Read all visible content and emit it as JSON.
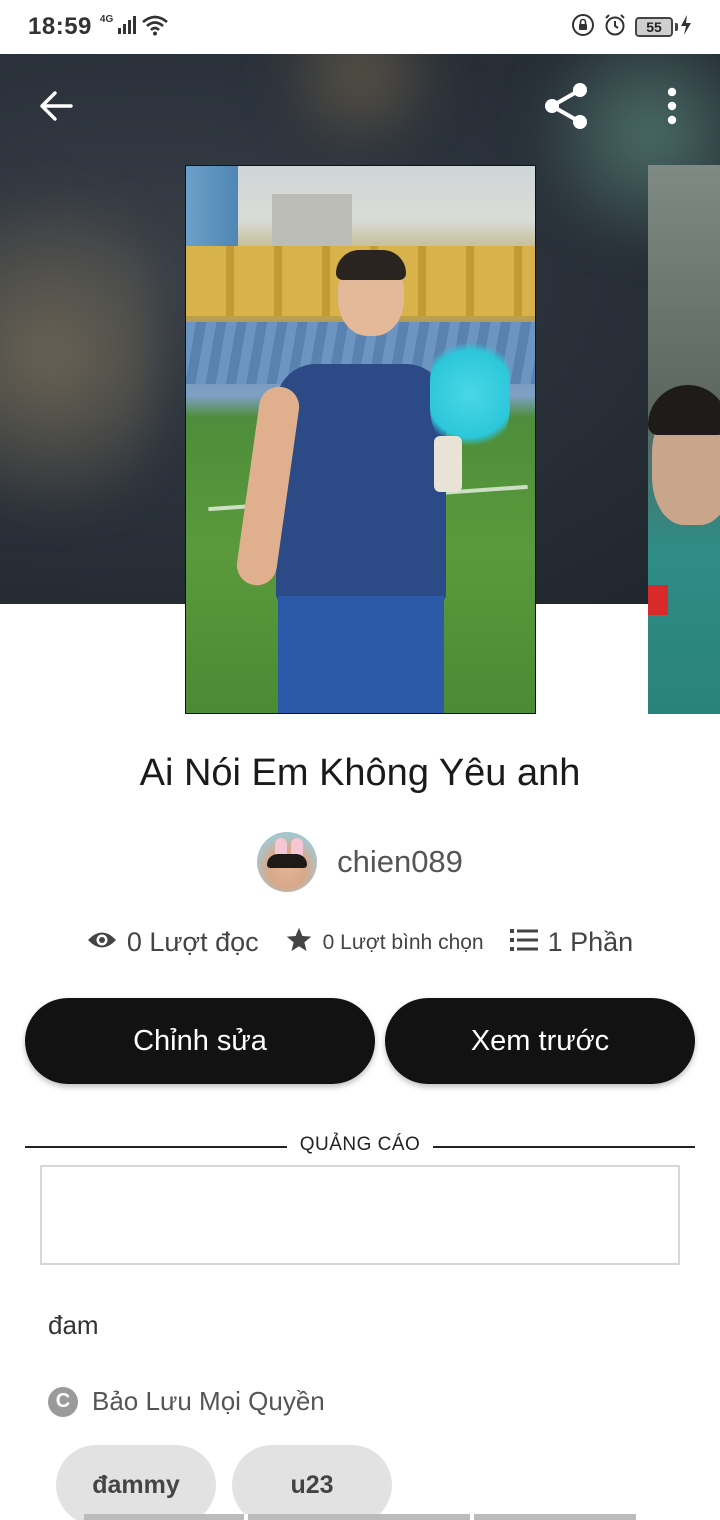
{
  "status_bar": {
    "time": "18:59",
    "network": "4G",
    "battery": "55"
  },
  "toolbar": {
    "back_icon": "back-arrow-icon",
    "share_icon": "share-icon",
    "more_icon": "more-vert-icon"
  },
  "story": {
    "title": "Ai Nói Em Không Yêu anh",
    "author": "chien089",
    "stats": {
      "reads": "0 Lượt đọc",
      "votes": "0 Lượt bình chọn",
      "parts": "1 Phần"
    },
    "description": "đam",
    "copyright": "Bảo Lưu Mọi Quyền",
    "tags": [
      "đammy",
      "u23"
    ]
  },
  "actions": {
    "edit_label": "Chỉnh sửa",
    "preview_label": "Xem trước"
  },
  "ad": {
    "label": "QUẢNG CÁO"
  },
  "colors": {
    "button_bg": "#121212",
    "tag_bg": "#e2e2e2",
    "text_primary": "#1a1a1a"
  }
}
